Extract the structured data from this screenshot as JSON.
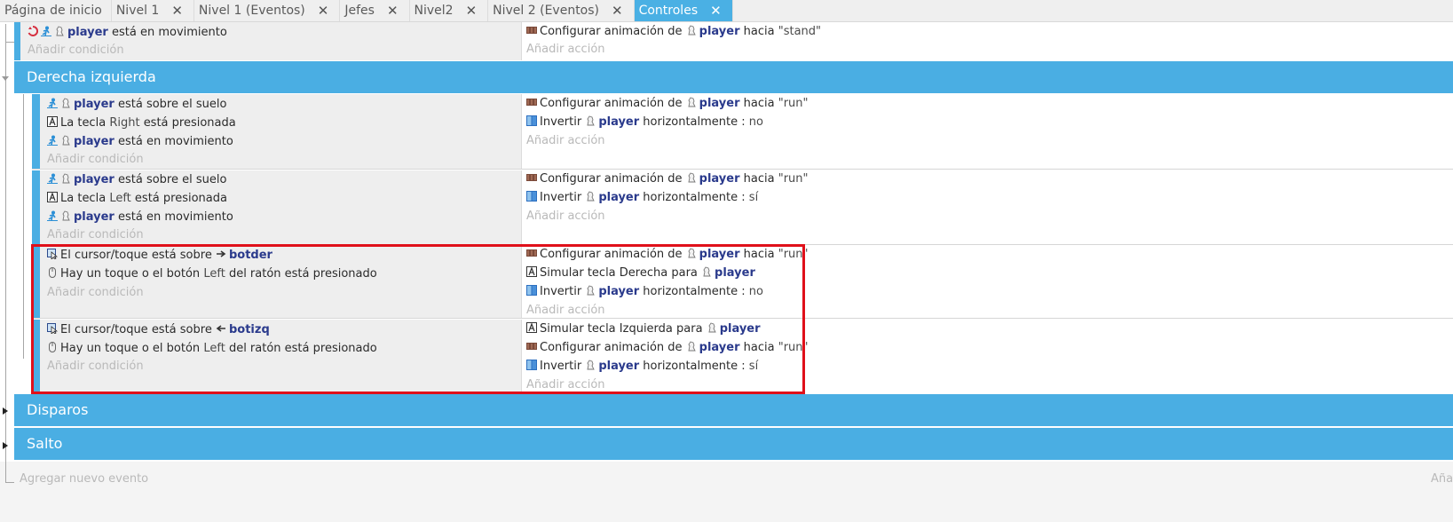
{
  "tabs": [
    {
      "label": "Página de inicio",
      "closable": false,
      "active": false
    },
    {
      "label": "Nivel 1",
      "closable": true,
      "active": false
    },
    {
      "label": "Nivel 1 (Eventos)",
      "closable": true,
      "active": false
    },
    {
      "label": "Jefes",
      "closable": true,
      "active": false
    },
    {
      "label": "Nivel2",
      "closable": true,
      "active": false
    },
    {
      "label": "Nivel 2 (Eventos)",
      "closable": true,
      "active": false
    },
    {
      "label": "Controles",
      "closable": true,
      "active": true
    }
  ],
  "close_glyph": "✕",
  "common": {
    "player": "player",
    "add_condition": "Añadir condición",
    "add_action": "Añadir acción",
    "anim_prefix": "Configurar animación de",
    "anim_to": "hacia",
    "flip_prefix": "Invertir",
    "flip_suffix": "horizontalmente :",
    "on_floor": "está sobre el suelo",
    "moving": "está en movimiento",
    "key_prefix": "La tecla",
    "key_suffix": "está presionada",
    "cursor_prefix": "El cursor/toque está sobre",
    "mouse_prefix": "Hay un toque o el botón",
    "mouse_suffix": "del ratón está presionado",
    "sim_key_prefix": "Simular tecla",
    "sim_key_for": "para"
  },
  "event0": {
    "cond_moving": "player",
    "action_anim_value": "\"stand\""
  },
  "groups": {
    "derecha": "Derecha izquierda",
    "disparos": "Disparos",
    "salto": "Salto"
  },
  "event1": {
    "key": "Right",
    "anim_value": "\"run\"",
    "flip_value": "no"
  },
  "event2": {
    "key": "Left",
    "anim_value": "\"run\"",
    "flip_value": "sí"
  },
  "event3": {
    "object": "botder",
    "mouse_button": "Left",
    "anim_value": "\"run\"",
    "sim_key": "Derecha",
    "flip_value": "no"
  },
  "event4": {
    "object": "botizq",
    "mouse_button": "Left",
    "sim_key": "Izquierda",
    "anim_value": "\"run\"",
    "flip_value": "sí"
  },
  "footer": {
    "add_event": "Agregar nuevo evento",
    "right_hint": "Aña"
  },
  "colors": {
    "accent": "#4aaee3",
    "highlight": "#e0101a",
    "object_text": "#2a3a8c"
  },
  "icons": [
    "sprite-anim-icon",
    "flip-icon",
    "keyboard-icon",
    "platformer-icon",
    "player-sprite-icon",
    "cursor-object-icon",
    "mouse-icon",
    "trigger-once-icon",
    "arrow-right-icon",
    "arrow-left-icon"
  ]
}
